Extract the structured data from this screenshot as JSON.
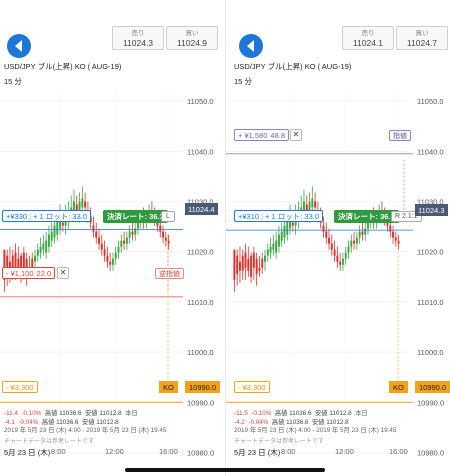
{
  "y_ticks": [
    "11050.0",
    "11040.0",
    "11030.0",
    "11020.0",
    "11010.0",
    "11000.0",
    "10990.0",
    "10980.0"
  ],
  "x_ticks": [
    "8:00",
    "12:00",
    "16:00"
  ],
  "palette": {
    "up": "#3aa845",
    "down": "#e0302a",
    "accent": "#1e77d6",
    "ko": "#f2a21b",
    "stop": "#e2463a",
    "limit": "#8a84cc",
    "current": "#4a5a74"
  },
  "icons": {
    "back": "back-arrow-icon",
    "close": "close-x-icon"
  },
  "chart_data": [
    {
      "type": "candlestick",
      "title": "USD/JPY ブル(上昇) KO ( AUG-19)",
      "timeframe": "15 分",
      "y_range": [
        10978,
        11055
      ],
      "current_price": 11024.4,
      "ko_price": 10990.0,
      "stop_price": 11011.0
    },
    {
      "type": "candlestick",
      "title": "USD/JPY ブル(上昇) KO ( AUG-19)",
      "timeframe": "15 分",
      "y_range": [
        10978,
        11055
      ],
      "current_price": 11024.3,
      "ko_price": 10990.0,
      "limit_price": 11039.5
    }
  ],
  "panels": [
    {
      "sell_label": "売り",
      "sell_value": "11024.3",
      "buy_label": "買い",
      "buy_value": "11024.9",
      "title": "USD/JPY ブル(上昇) KO ( AUG-19)",
      "timeframe": "15 分",
      "position": {
        "pnl": "+¥330",
        "lots": "+ 1 ロット: 33.0",
        "rate": "決済レート: 36.3",
        "tag": "L"
      },
      "current_price_tag": "11024.4",
      "stop": {
        "pnl": "- ¥1,100",
        "val": "22.0",
        "tag": "逆指値",
        "x": "✕"
      },
      "ko": {
        "pnl": "- ¥3,300",
        "tag": "KO",
        "price": "10990.0"
      },
      "stats": {
        "l1_change": "-11.4",
        "l1_pct": "-0.10%",
        "l1_high": "高値 11036.6",
        "l1_low": "安値 11012.8",
        "l1_tag": "本日",
        "l2_change": "-4.1",
        "l2_pct": "-0.04%",
        "l2_high": "高値 11036.6",
        "l2_low": "安値 11012.8",
        "l3": "2019 年 5月 23 日 (木) 4:00 - 2019 年 5月 23 日 (木) 19:45"
      },
      "note": "チャートデータは参考レートです",
      "date": "5月 23 日 (木)"
    },
    {
      "sell_label": "売り",
      "sell_value": "11024.1",
      "buy_label": "買い",
      "buy_value": "11024.7",
      "title": "USD/JPY ブル(上昇) KO ( AUG-19)",
      "timeframe": "15 分",
      "position": {
        "pnl": "+¥310",
        "lots": "+ 1 ロット: 33.0",
        "rate": "決済レート: 36.1",
        "tag": "R 2.1:1"
      },
      "current_price_tag": "11024.3",
      "limit": {
        "pnl": "+ ¥1,580",
        "val": "48.8",
        "tag": "指値",
        "x": "✕"
      },
      "ko": {
        "pnl": "- ¥3,300",
        "tag": "KO",
        "price": "10990.0"
      },
      "stats": {
        "l1_change": "-11.5",
        "l1_pct": "-0.10%",
        "l1_high": "高値 11036.6",
        "l1_low": "安値 11012.8",
        "l1_tag": "本日",
        "l2_change": "-4.2",
        "l2_pct": "-0.04%",
        "l2_high": "高値 11036.6",
        "l2_low": "安値 11012.8",
        "l3": "2019 年 5月 23 日 (木) 4:00 - 2019 年 5月 23 日 (木) 19:45"
      },
      "note": "チャートデータは参考レートです",
      "date": "5月 23 日 (木)"
    }
  ]
}
